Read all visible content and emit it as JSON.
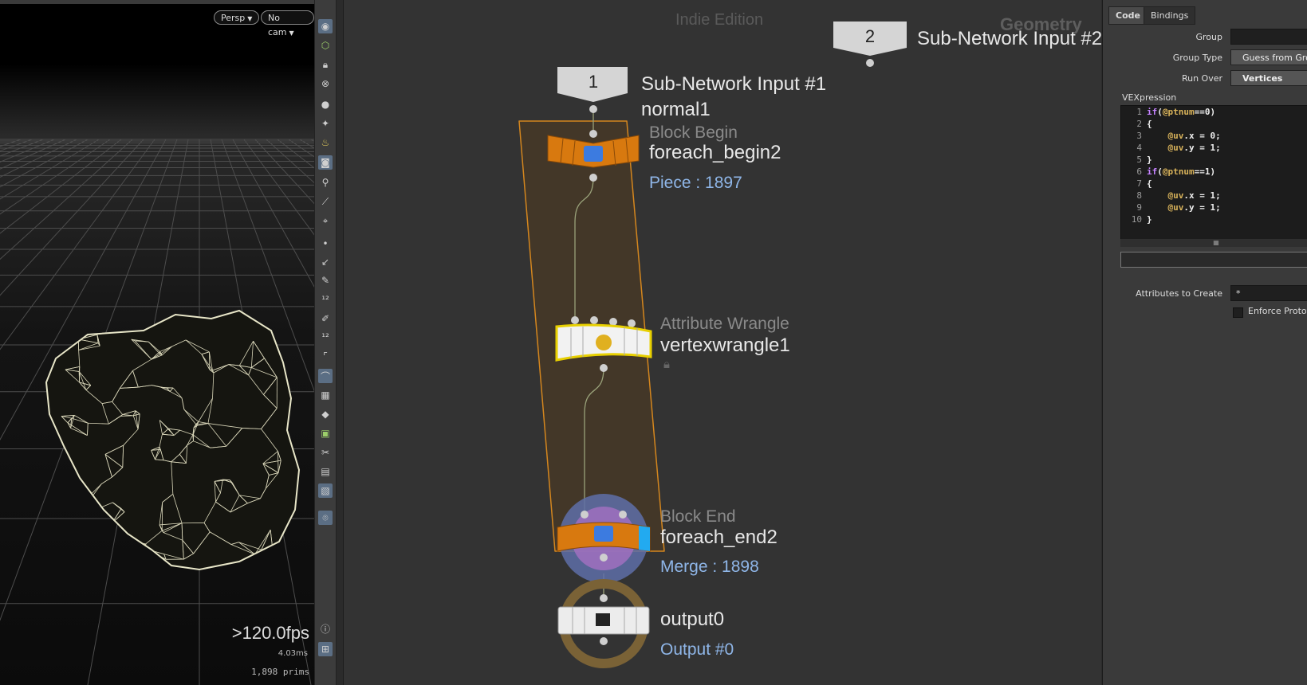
{
  "viewport": {
    "persp_label": "Persp",
    "cam_label": "No cam",
    "fps": ">120.0fps",
    "ms": "4.03ms",
    "prims": "1,898  prims"
  },
  "toolbar": {
    "icons": [
      "view-icon",
      "select-icon",
      "lock-icon",
      "hide-icon",
      "shade-icon",
      "light-icon",
      "bulb-icon",
      "camera-icon",
      "handle-icon",
      "wire-icon",
      "snap-icon",
      "point-icon",
      "edge-icon",
      "pin-icon",
      "number-icon",
      "brush-icon",
      "number2-icon",
      "corner-icon",
      "magnet-icon",
      "grid-icon",
      "diamond-icon",
      "mask-icon",
      "knife-icon",
      "stack-icon",
      "image-icon",
      "map-pin-icon"
    ],
    "bottom_icons": [
      "info-icon",
      "layout-icon"
    ]
  },
  "network": {
    "watermark": "Indie Edition",
    "context_label": "Geometry",
    "input1": {
      "number": "1",
      "label": "Sub-Network Input #1"
    },
    "input2": {
      "number": "2",
      "label": "Sub-Network Input #2"
    },
    "nodes": {
      "normal": {
        "name": "normal1"
      },
      "foreach_begin": {
        "type": "Block Begin",
        "name": "foreach_begin2",
        "info": "Piece : 1897"
      },
      "wrangle": {
        "type": "Attribute Wrangle",
        "name": "vertexwrangle1"
      },
      "foreach_end": {
        "type": "Block End",
        "name": "foreach_end2",
        "info": "Merge : 1898"
      },
      "output": {
        "name": "output0",
        "info": "Output #0"
      }
    },
    "colors": {
      "block": "#c87a1e",
      "wrangle_border": "#e8d000",
      "info": "#8fb6e8"
    }
  },
  "params": {
    "tabs": [
      "Code",
      "Bindings"
    ],
    "active_tab": "Code",
    "group_label": "Group",
    "group_value": "",
    "group_type_label": "Group Type",
    "group_type_value": "Guess from Grou",
    "run_over_label": "Run Over",
    "run_over_value": "Vertices",
    "vex_label": "VEXpression",
    "code_lines": [
      "if(@ptnum==0)",
      "{",
      "    @uv.x = 0;",
      "    @uv.y = 1;",
      "}",
      "if(@ptnum==1)",
      "{",
      "    @uv.x = 1;",
      "    @uv.y = 1;",
      "}"
    ],
    "attrs_label": "Attributes to Create",
    "attrs_value": "*",
    "enforce_label": "Enforce Prototy"
  }
}
